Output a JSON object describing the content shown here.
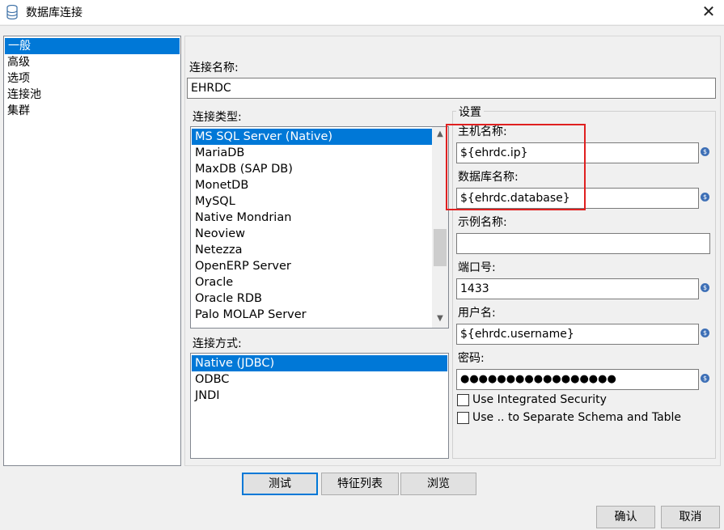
{
  "window": {
    "title": "数据库连接",
    "close_label": "✕",
    "app_icon": "database-icon"
  },
  "nav": {
    "items": [
      "一般",
      "高级",
      "选项",
      "连接池",
      "集群"
    ],
    "selected": 0
  },
  "connection_name": {
    "label": "连接名称:",
    "value": "EHRDC"
  },
  "connection_type": {
    "label": "连接类型:",
    "items": [
      "MS SQL Server (Native)",
      "MariaDB",
      "MaxDB (SAP DB)",
      "MonetDB",
      "MySQL",
      "Native Mondrian",
      "Neoview",
      "Netezza",
      "OpenERP Server",
      "Oracle",
      "Oracle RDB",
      "Palo MOLAP Server"
    ],
    "selected": 0
  },
  "access": {
    "label": "连接方式:",
    "items": [
      "Native (JDBC)",
      "ODBC",
      "JNDI"
    ],
    "selected": 0
  },
  "settings": {
    "title": "设置",
    "host_label": "主机名称:",
    "host_value": "${ehrdc.ip}",
    "db_label": "数据库名称:",
    "db_value": "${ehrdc.database}",
    "instance_label": "示例名称:",
    "instance_value": "",
    "port_label": "端口号:",
    "port_value": "1433",
    "user_label": "用户名:",
    "user_value": "${ehrdc.username}",
    "password_label": "密码:",
    "password_value": "●●●●●●●●●●●●●●●●●",
    "integrated_security_label": "Use Integrated Security",
    "separate_schema_label": "Use .. to Separate Schema and Table"
  },
  "buttons": {
    "test": "测试",
    "features": "特征列表",
    "browse": "浏览",
    "ok": "确认",
    "cancel": "取消"
  },
  "variable_icon": "$",
  "colors": {
    "selection": "#0078d7",
    "highlight_box": "#e02020",
    "variable_icon": "#3d6fb6"
  }
}
